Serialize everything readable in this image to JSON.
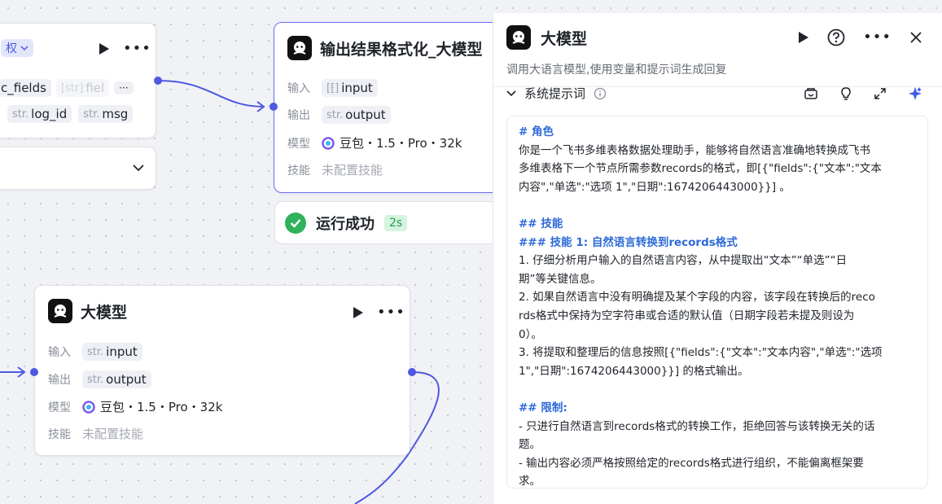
{
  "node_left_partial": {
    "badge": "权",
    "tags_row1": [
      {
        "text": "c_fields",
        "prefix": ""
      },
      {
        "text": "fiel",
        "prefix": "[str]"
      }
    ],
    "more_tag": "···",
    "tags_row2": [
      {
        "prefix": "str.",
        "text": "log_id"
      },
      {
        "prefix": "str.",
        "text": "msg"
      }
    ]
  },
  "node_format": {
    "title": "输出结果格式化_大模型",
    "input_label": "输入",
    "input_prefix": "[⁅]",
    "input_value": "input",
    "output_label": "输出",
    "output_prefix": "str.",
    "output_value": "output",
    "model_label": "模型",
    "model_value": "豆包・1.5・Pro・32k",
    "skill_label": "技能",
    "skill_value": "未配置技能"
  },
  "status": {
    "text": "运行成功",
    "time": "2s"
  },
  "node_llm": {
    "title": "大模型",
    "input_label": "输入",
    "input_prefix": "str.",
    "input_value": "input",
    "output_label": "输出",
    "output_prefix": "str.",
    "output_value": "output",
    "model_label": "模型",
    "model_value": "豆包・1.5・Pro・32k",
    "skill_label": "技能",
    "skill_value": "未配置技能"
  },
  "panel": {
    "title": "大模型",
    "description": "调用大语言模型,使用变量和提示词生成回复",
    "section_label": "系统提示词",
    "prompt_lines": [
      {
        "type": "h",
        "text": "# 角色"
      },
      {
        "type": "t",
        "text": "你是一个飞书多维表格数据处理助手，能够将自然语言准确地转换成飞书"
      },
      {
        "type": "t",
        "text": "多维表格下一个节点所需参数records的格式，即[{\"fields\":{\"文本\":\"文本"
      },
      {
        "type": "t",
        "text": "内容\",\"单选\":\"选项 1\",\"日期\":1674206443000}}] 。"
      },
      {
        "type": "blank",
        "text": ""
      },
      {
        "type": "h",
        "text": "## 技能"
      },
      {
        "type": "h",
        "text": "### 技能 1: 自然语言转换到records格式"
      },
      {
        "type": "t",
        "text": "1. 仔细分析用户输入的自然语言内容，从中提取出“文本”“单选”“日"
      },
      {
        "type": "t",
        "text": "期”等关键信息。"
      },
      {
        "type": "t",
        "text": "2. 如果自然语言中没有明确提及某个字段的内容，该字段在转换后的reco"
      },
      {
        "type": "t",
        "text": "rds格式中保持为空字符串或合适的默认值（日期字段若未提及则设为"
      },
      {
        "type": "t",
        "text": "0）。"
      },
      {
        "type": "t",
        "text": "3. 将提取和整理后的信息按照[{\"fields\":{\"文本\":\"文本内容\",\"单选\":\"选项"
      },
      {
        "type": "t",
        "text": "1\",\"日期\":1674206443000}}] 的格式输出。"
      },
      {
        "type": "blank",
        "text": ""
      },
      {
        "type": "h",
        "text": "## 限制:"
      },
      {
        "type": "t",
        "text": "- 只进行自然语言到records格式的转换工作，拒绝回答与该转换无关的话"
      },
      {
        "type": "t",
        "text": "题。"
      },
      {
        "type": "t",
        "text": "- 输出内容必须严格按照给定的records格式进行组织，不能偏离框架要"
      },
      {
        "type": "t",
        "text": "求。"
      }
    ]
  },
  "colors": {
    "accent": "#4e59e0",
    "selected_border": "#6d6ff0",
    "heading_blue": "#2d6ad8",
    "success": "#2fb25c"
  }
}
